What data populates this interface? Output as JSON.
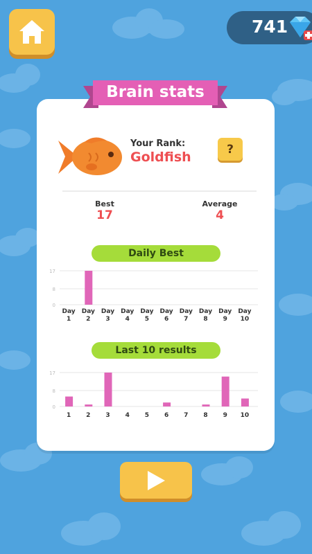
{
  "header": {
    "gem_count": "741"
  },
  "panel": {
    "title": "Brain stats",
    "rank_label": "Your Rank:",
    "rank_value": "Goldfish",
    "help_label": "?",
    "best_label": "Best",
    "best_value": "17",
    "average_label": "Average",
    "average_value": "4",
    "daily_title": "Daily Best",
    "last10_title": "Last 10 results"
  },
  "chart_data": [
    {
      "type": "bar",
      "title": "Daily Best",
      "categories": [
        "Day 1",
        "Day 2",
        "Day 3",
        "Day 4",
        "Day 5",
        "Day 6",
        "Day 7",
        "Day 8",
        "Day 9",
        "Day 10"
      ],
      "yticks": [
        0,
        8,
        17
      ],
      "ylim": [
        0,
        17
      ],
      "values": [
        0,
        17,
        0,
        0,
        0,
        0,
        0,
        0,
        0,
        0
      ],
      "bar_color": "#e066b8"
    },
    {
      "type": "bar",
      "title": "Last 10 results",
      "categories": [
        "1",
        "2",
        "3",
        "4",
        "5",
        "6",
        "7",
        "8",
        "9",
        "10"
      ],
      "yticks": [
        0,
        8,
        17
      ],
      "ylim": [
        0,
        17
      ],
      "values": [
        5,
        1,
        17,
        0,
        0,
        2,
        0,
        1,
        15,
        4
      ],
      "bar_color": "#e066b8"
    }
  ]
}
